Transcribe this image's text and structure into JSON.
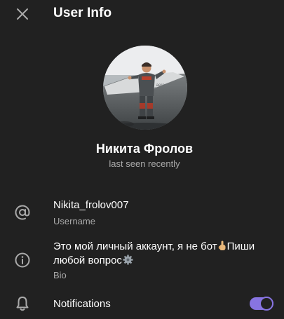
{
  "header": {
    "title": "User Info",
    "close_icon": "close-icon"
  },
  "profile": {
    "name": "Никита Фролов",
    "status": "last seen recently",
    "avatar_icon": "user-photo"
  },
  "username_row": {
    "icon": "at-sign-icon",
    "value": "Nikita_frolov007",
    "label": "Username"
  },
  "bio_row": {
    "icon": "info-icon",
    "text_part1": "Это мой личный аккаунт, я не бот",
    "emoji1": "hand-pointing-up-emoji",
    "text_part2": "Пиши любой вопрос",
    "emoji2": "gear-emoji",
    "label": "Bio"
  },
  "notifications_row": {
    "icon": "bell-icon",
    "label": "Notifications",
    "enabled": true
  },
  "colors": {
    "background": "#212121",
    "accent": "#8774e1",
    "secondary_text": "#aaaaaa"
  }
}
